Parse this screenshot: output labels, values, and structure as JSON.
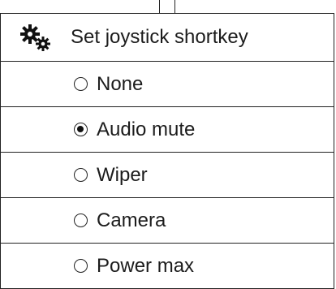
{
  "header": {
    "title": "Set joystick shortkey",
    "icon": "gears-icon"
  },
  "options": [
    {
      "label": "None",
      "selected": false
    },
    {
      "label": "Audio mute",
      "selected": true
    },
    {
      "label": "Wiper",
      "selected": false
    },
    {
      "label": "Camera",
      "selected": false
    },
    {
      "label": "Power max",
      "selected": false
    }
  ]
}
